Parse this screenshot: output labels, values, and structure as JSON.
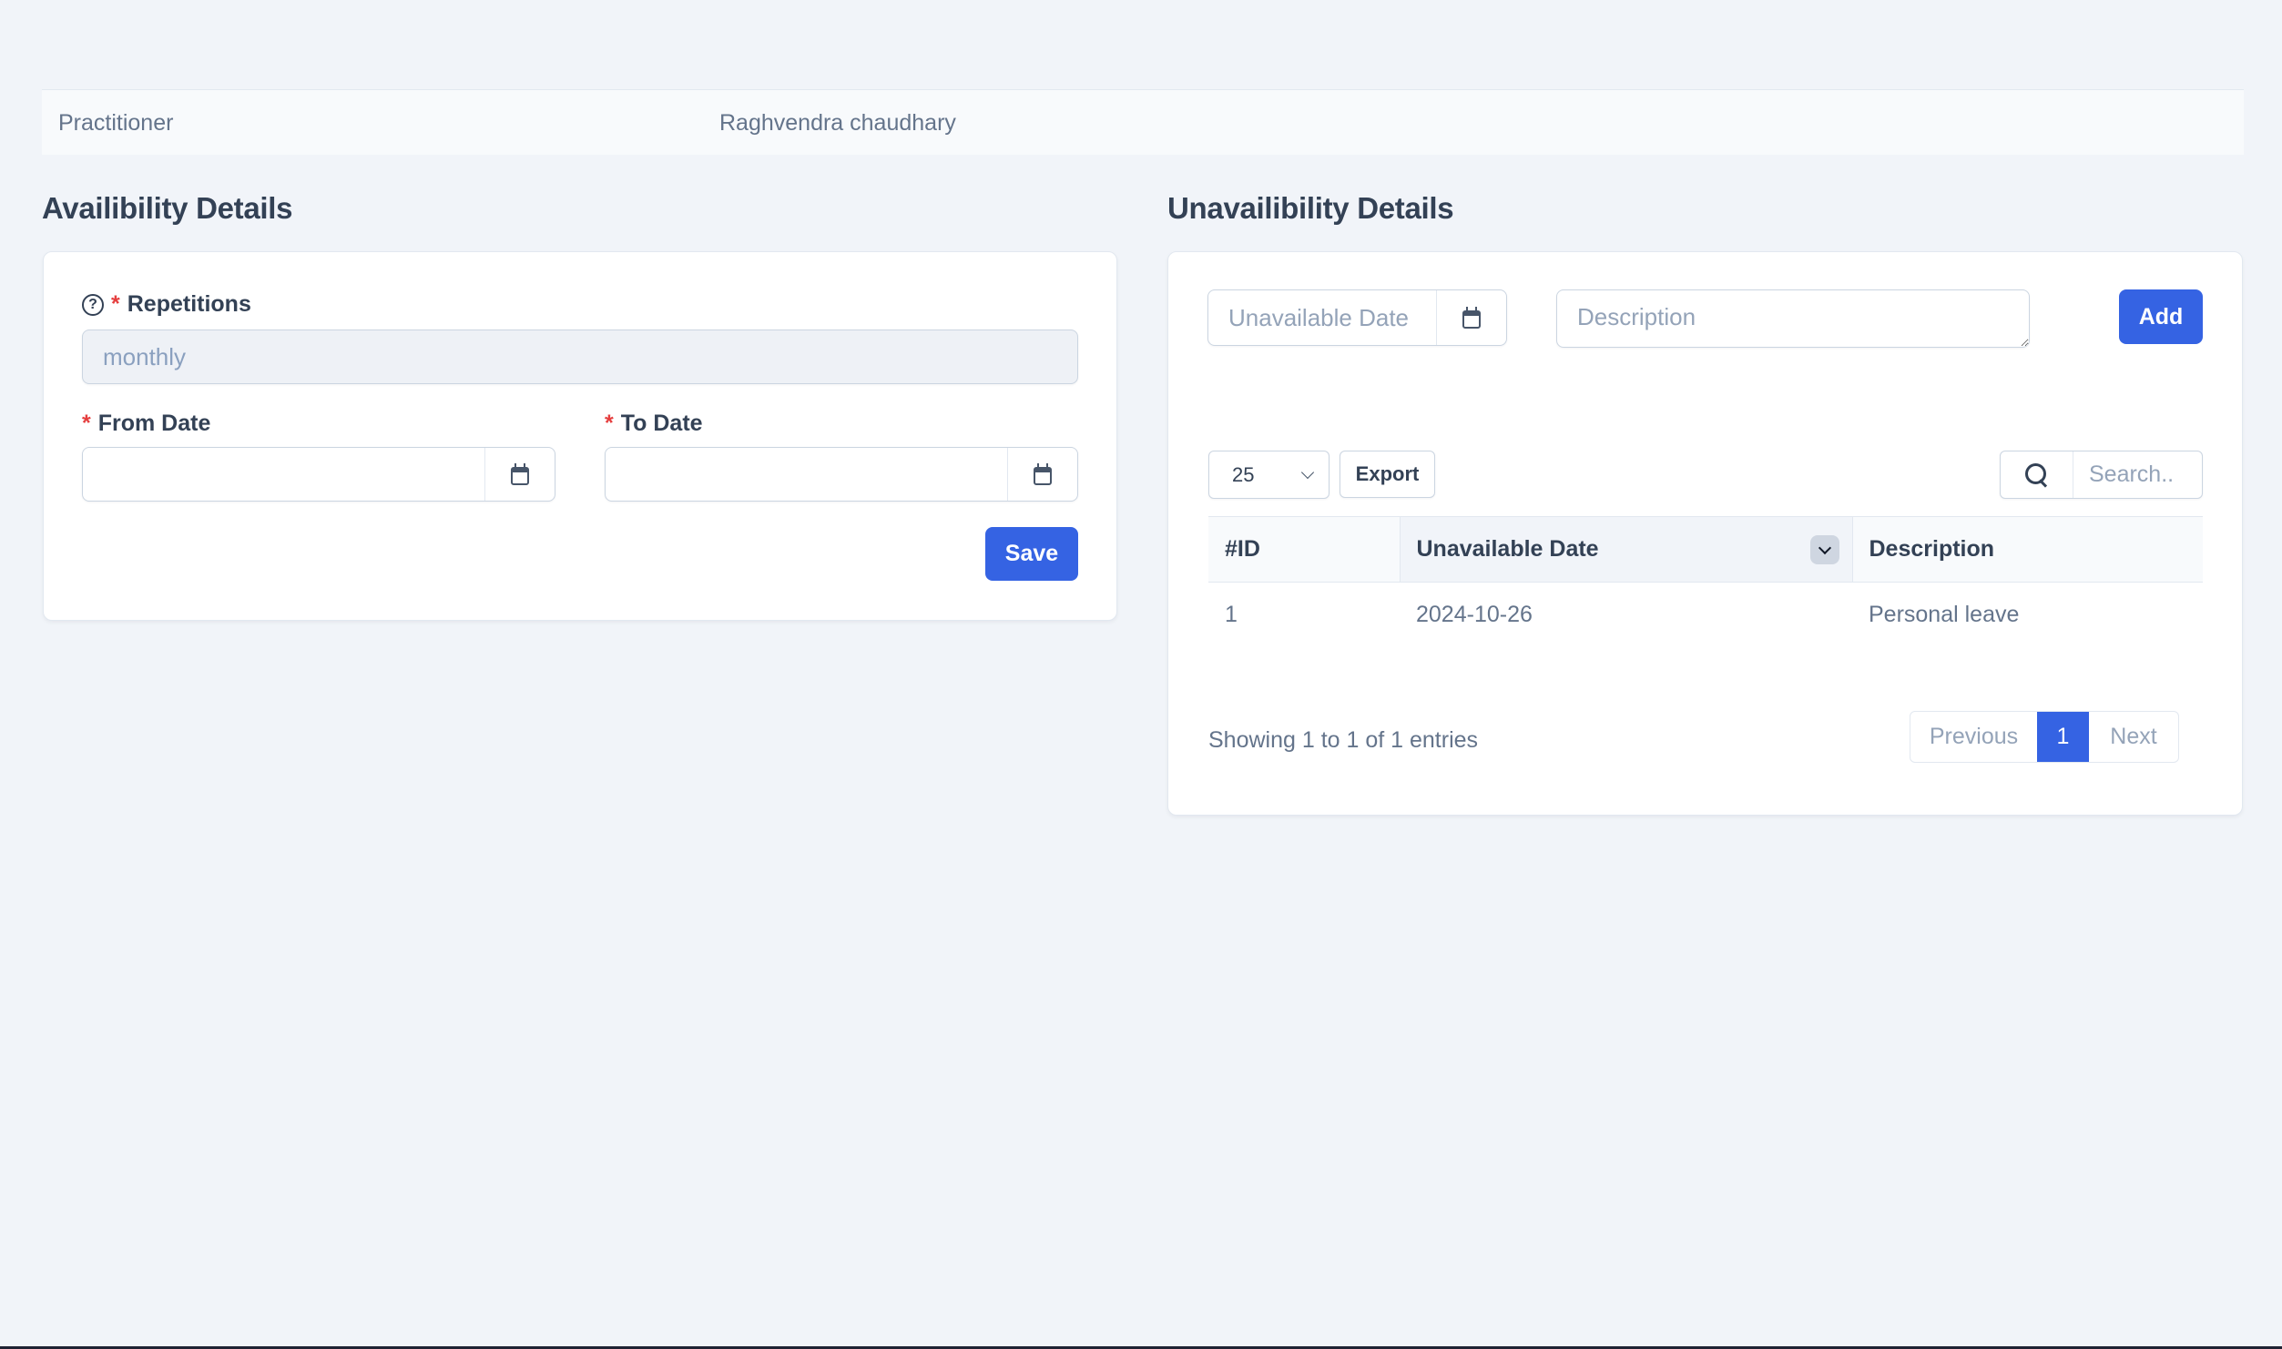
{
  "practitioner": {
    "label": "Practitioner",
    "value": "Raghvendra chaudhary"
  },
  "availability": {
    "title": "Availibility Details",
    "repetitions": {
      "label": "Repetitions",
      "required": "*",
      "value": "monthly",
      "help_icon": "question-circle-icon"
    },
    "from_date": {
      "label": "From Date",
      "required": "*",
      "value": "",
      "icon": "calendar-icon"
    },
    "to_date": {
      "label": "To Date",
      "required": "*",
      "value": "",
      "icon": "calendar-icon"
    },
    "save_label": "Save"
  },
  "unavailability": {
    "title": "Unavailibility Details",
    "date_input": {
      "placeholder": "Unavailable Date",
      "value": "",
      "icon": "calendar-icon"
    },
    "description_input": {
      "placeholder": "Description",
      "value": ""
    },
    "add_label": "Add",
    "page_size": {
      "selected": "25"
    },
    "export_label": "Export",
    "search": {
      "placeholder": "Search..",
      "value": "",
      "icon": "search-icon"
    },
    "table": {
      "columns": [
        "#ID",
        "Unavailable Date",
        "Description"
      ],
      "rows": [
        {
          "id": "1",
          "date": "2024-10-26",
          "description": "Personal leave"
        }
      ]
    },
    "footer": {
      "summary": "Showing 1 to 1 of 1 entries",
      "previous": "Previous",
      "current_page": "1",
      "next": "Next"
    }
  },
  "colors": {
    "primary": "#3563e3",
    "required": "#e53e3e",
    "background": "#f1f4f9"
  }
}
